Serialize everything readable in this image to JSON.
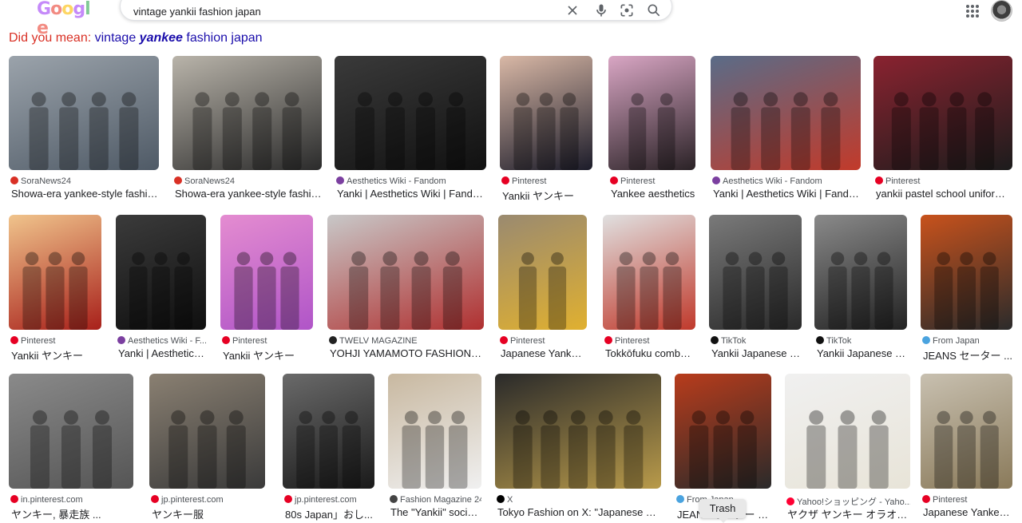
{
  "search": {
    "logo_text": "Google",
    "query": "vintage yankii fashion japan"
  },
  "spelling": {
    "prefix": "Did you mean:",
    "suggestion_before": "vintage",
    "suggestion_bold": "yankee",
    "suggestion_after": "fashion japan"
  },
  "results": [
    {
      "source": "SoraNews24",
      "title": "Showa-era yankee-style fashion ...",
      "fav_color": "#d93025",
      "fav_icon": "soranews-icon"
    },
    {
      "source": "SoraNews24",
      "title": "Showa-era yankee-style fashion ...",
      "fav_color": "#d93025",
      "fav_icon": "soranews-icon"
    },
    {
      "source": "Aesthetics Wiki - Fandom",
      "title": "Yanki | Aesthetics Wiki | Fandom",
      "fav_color": "#7b3fa0",
      "fav_icon": "fandom-icon"
    },
    {
      "source": "Pinterest",
      "title": "Yankii ヤンキー",
      "fav_color": "#e60023",
      "fav_icon": "pinterest-icon"
    },
    {
      "source": "Pinterest",
      "title": "Yankee aesthetics",
      "fav_color": "#e60023",
      "fav_icon": "pinterest-icon"
    },
    {
      "source": "Aesthetics Wiki - Fandom",
      "title": "Yanki | Aesthetics Wiki | Fandom",
      "fav_color": "#7b3fa0",
      "fav_icon": "fandom-icon"
    },
    {
      "source": "Pinterest",
      "title": "yankii pastel school uniform - ...",
      "fav_color": "#e60023",
      "fav_icon": "pinterest-icon"
    },
    {
      "source": "Pinterest",
      "title": "Yankii ヤンキー",
      "fav_color": "#e60023",
      "fav_icon": "pinterest-icon"
    },
    {
      "source": "Aesthetics Wiki - F...",
      "title": "Yanki | Aesthetics ...",
      "fav_color": "#7b3fa0",
      "fav_icon": "fandom-icon"
    },
    {
      "source": "Pinterest",
      "title": "Yankii ヤンキー",
      "fav_color": "#e60023",
      "fav_icon": "pinterest-icon"
    },
    {
      "source": "TWELV MAGAZINE",
      "title": "YOHJI YAMAMOTO FASHION ST...",
      "fav_color": "#222222",
      "fav_icon": "twelv-icon"
    },
    {
      "source": "Pinterest",
      "title": "Japanese Yankee ...",
      "fav_color": "#e60023",
      "fav_icon": "pinterest-icon"
    },
    {
      "source": "Pinterest",
      "title": "Tokkōfuku combat ...",
      "fav_color": "#e60023",
      "fav_icon": "pinterest-icon"
    },
    {
      "source": "TikTok",
      "title": "Yankii Japanese F...",
      "fav_color": "#111111",
      "fav_icon": "tiktok-icon"
    },
    {
      "source": "TikTok",
      "title": "Yankii Japanese F...",
      "fav_color": "#111111",
      "fav_icon": "tiktok-icon"
    },
    {
      "source": "From Japan",
      "title": "JEANS セーター ...",
      "fav_color": "#4aa3df",
      "fav_icon": "fromjapan-icon"
    },
    {
      "source": "in.pinterest.com",
      "title": "ヤンキー, 暴走族 ...",
      "fav_color": "#e60023",
      "fav_icon": "pinterest-icon"
    },
    {
      "source": "jp.pinterest.com",
      "title": "ヤンキー服",
      "fav_color": "#e60023",
      "fav_icon": "pinterest-icon"
    },
    {
      "source": "jp.pinterest.com",
      "title": "80s Japan」おし...",
      "fav_color": "#e60023",
      "fav_icon": "pinterest-icon"
    },
    {
      "source": "Fashion Magazine 24",
      "title": "The \"Yankii\" societ...",
      "fav_color": "#444444",
      "fav_icon": "fashionmag-icon"
    },
    {
      "source": "X",
      "title": "Tokyo Fashion on X: \"Japanese Yank...",
      "fav_color": "#000000",
      "fav_icon": "x-icon"
    },
    {
      "source": "From Japan",
      "title": "JEANS セーター カ...",
      "fav_color": "#4aa3df",
      "fav_icon": "fromjapan-icon"
    },
    {
      "source": "Yahoo!ショッピング - Yaho...",
      "title": "ヤクザ ヤンキー オラオラ ...",
      "fav_color": "#ff0033",
      "fav_icon": "yahoo-icon"
    },
    {
      "source": "Pinterest",
      "title": "Japanese Yankee ...",
      "fav_color": "#e60023",
      "fav_icon": "pinterest-icon"
    }
  ],
  "thumb_colors": [
    [
      "#9ba3ab",
      "#4f5a66"
    ],
    [
      "#b9b4aa",
      "#2b2b2b"
    ],
    [
      "#3a3a3a",
      "#111111"
    ],
    [
      "#d9b8a6",
      "#1c1c2a"
    ],
    [
      "#d9a6c4",
      "#2a2226"
    ],
    [
      "#5a6c88",
      "#c23a2a"
    ],
    [
      "#8a2330",
      "#1c1c1c"
    ],
    [
      "#f0c48c",
      "#a8201a"
    ],
    [
      "#3b3b3b",
      "#0f0f0f"
    ],
    [
      "#e48cd0",
      "#b055c8"
    ],
    [
      "#c8c8c8",
      "#b03030"
    ],
    [
      "#9a8a70",
      "#e0b030"
    ],
    [
      "#e0e0e0",
      "#c0392b"
    ],
    [
      "#7a7a7a",
      "#2a2a2a"
    ],
    [
      "#8a8a8a",
      "#222222"
    ],
    [
      "#c8521c",
      "#2b2b2b"
    ],
    [
      "#8a8a8a",
      "#555555"
    ],
    [
      "#8a8072",
      "#3a3a3a"
    ],
    [
      "#6a6a6a",
      "#1a1a1a"
    ],
    [
      "#c8b8a0",
      "#f0f0f0"
    ],
    [
      "#2a2a2a",
      "#b89a4a"
    ],
    [
      "#b83c1c",
      "#2a2a2a"
    ],
    [
      "#f0f0f0",
      "#e8e4d8"
    ],
    [
      "#c8c0b0",
      "#8a7a5a"
    ]
  ],
  "tooltip": "Trash"
}
